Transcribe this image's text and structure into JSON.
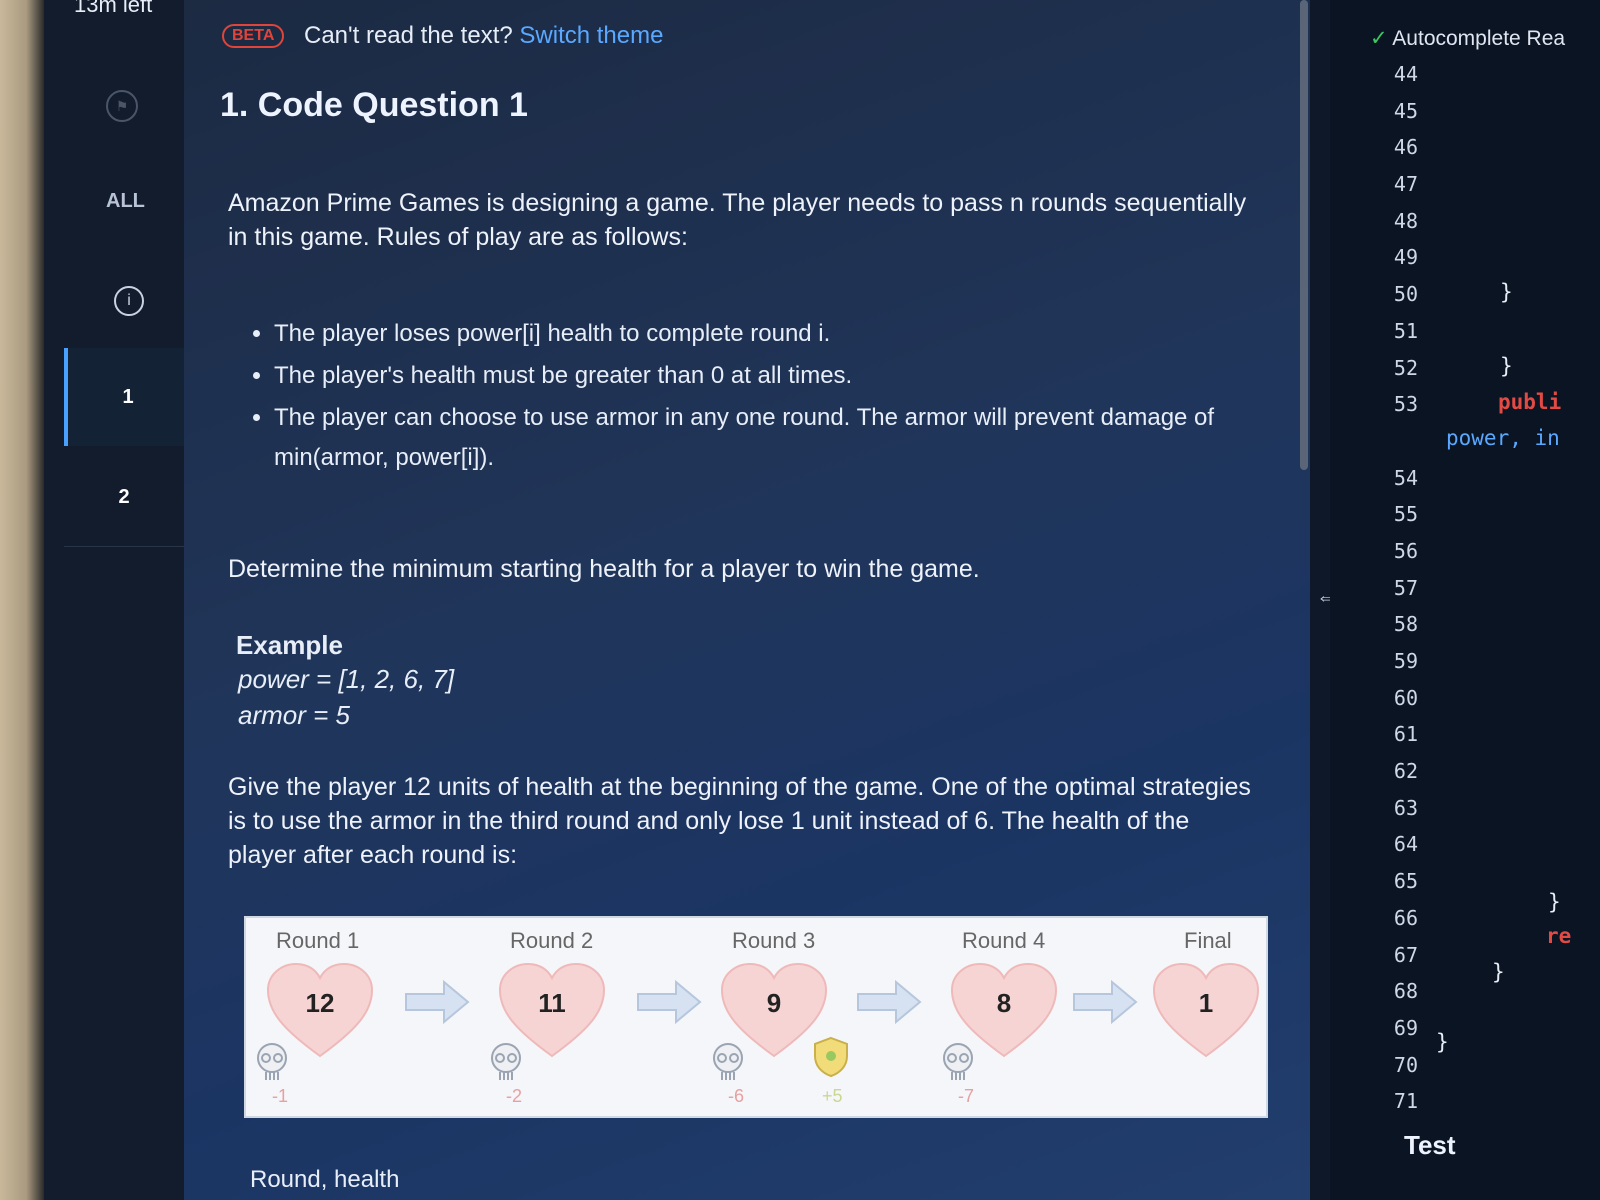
{
  "timer": "13m left",
  "sidebar": {
    "all_label": "ALL",
    "info_glyph": "i",
    "questions": [
      "1",
      "2"
    ]
  },
  "header": {
    "beta": "BETA",
    "cant_read": "Can't read the text?",
    "switch_theme": "Switch theme"
  },
  "question": {
    "title": "1. Code Question 1",
    "intro_1": "Amazon Prime Games is designing a game. The player needs to pass n rounds sequentially",
    "intro_2": "in this game. Rules of play are as follows:",
    "rules": [
      "The player loses power[i] health to complete round i.",
      "The player's health must be greater than 0 at all times.",
      "The player can choose to use armor in any one round. The armor will prevent damage of min(armor, power[i])."
    ],
    "task": "Determine the minimum starting health for a player to win the game.",
    "example_title": "Example",
    "example_power": "power = [1, 2, 6, 7]",
    "example_armor": "armor = 5",
    "explain_1": "Give the player 12 units of health at the beginning of the game. One of the optimal strategies",
    "explain_2": "is to use the armor in the third round and only lose 1 unit instead of 6. The health of the",
    "explain_3": "player after each round is:",
    "bottom_label": "Round, health"
  },
  "diagram": {
    "labels": [
      "Round 1",
      "Round 2",
      "Round 3",
      "Round 4",
      "Final"
    ],
    "health": [
      "12",
      "11",
      "9",
      "8",
      "1"
    ],
    "damage": [
      "-1",
      "-2",
      "-6",
      "-7"
    ],
    "armor_bonus": "+5",
    "icons": [
      "heart-icon",
      "arrow-right-icon",
      "skull-icon",
      "shield-icon"
    ]
  },
  "editor": {
    "autocomplete": "Autocomplete Rea",
    "line_numbers": [
      "44",
      "45",
      "46",
      "47",
      "48",
      "49",
      "50",
      "51",
      "52",
      "53",
      "",
      "54",
      "55",
      "56",
      "57",
      "58",
      "59",
      "60",
      "61",
      "62",
      "63",
      "64",
      "65",
      "66",
      "67",
      "68",
      "69",
      "70",
      "71"
    ],
    "code_fragments": {
      "publi": "publi",
      "power_in": "power, in",
      "brace": "}",
      "re": "re"
    },
    "test_label": "Test"
  },
  "colors": {
    "accent_blue": "#5aa8ff",
    "beta_red": "#e0443a",
    "keyword_red": "#e24a44",
    "check_green": "#3cc860"
  }
}
